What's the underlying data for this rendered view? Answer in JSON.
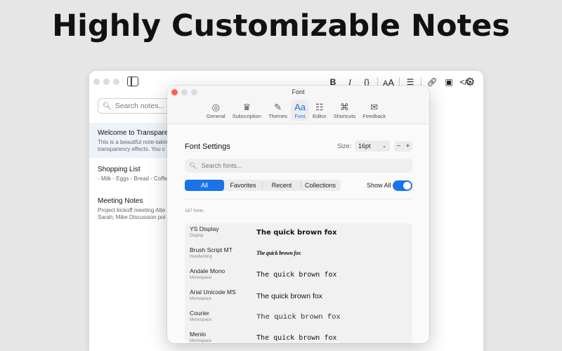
{
  "headline": "Highly Customizable Notes",
  "notes_window": {
    "search_placeholder": "Search notes...",
    "format_buttons": [
      "B",
      "I",
      "{}",
      "AA",
      "list",
      "link",
      "image",
      "</>"
    ],
    "notes": [
      {
        "title": "Welcome to Transparen",
        "preview": [
          "This is a beautiful note-takin",
          "transparency effects.  You c"
        ]
      },
      {
        "title": "Shopping List",
        "preview": [
          "- Milk - Eggs - Bread - Coffe"
        ]
      },
      {
        "title": "Meeting Notes",
        "preview": [
          "Project kickoff meeting  Atte",
          "Sarah, Mike  Discussion poi"
        ]
      }
    ]
  },
  "font_window": {
    "title": "Font",
    "tabs": [
      {
        "label": "General",
        "icon": "gauge-icon",
        "glyph": "◎"
      },
      {
        "label": "Subscription",
        "icon": "crown-icon",
        "glyph": "♛"
      },
      {
        "label": "Themes",
        "icon": "brush-icon",
        "glyph": "✎"
      },
      {
        "label": "Font",
        "icon": "font-icon",
        "glyph": "Aa"
      },
      {
        "label": "Editor",
        "icon": "document-icon",
        "glyph": "☷"
      },
      {
        "label": "Shortcuts",
        "icon": "command-icon",
        "glyph": "⌘"
      },
      {
        "label": "Feedback",
        "icon": "speech-bubble-icon",
        "glyph": "✉"
      }
    ],
    "active_tab": "Font",
    "settings_title": "Font Settings",
    "size_label": "Size:",
    "size_value": "16pt",
    "stepper_minus": "−",
    "stepper_plus": "+",
    "search_placeholder": "Search fonts...",
    "filters": [
      "All",
      "Favorites",
      "Recent",
      "Collections"
    ],
    "active_filter": "All",
    "show_all_label": "Show All",
    "show_all_on": true,
    "font_count": "187 fonts",
    "fonts": [
      {
        "name": "YS Display",
        "category": "Display",
        "sample": "The quick brown fox"
      },
      {
        "name": "Brush Script MT",
        "category": "Handwriting",
        "sample": "The quick brown fox"
      },
      {
        "name": "Andale Mono",
        "category": "Monospace",
        "sample": "The quick brown fox"
      },
      {
        "name": "Arial Unicode MS",
        "category": "Monospace",
        "sample": "The quick brown fox"
      },
      {
        "name": "Courier",
        "category": "Monospace",
        "sample": "The quick brown fox"
      },
      {
        "name": "Menlo",
        "category": "Monospace",
        "sample": "The quick brown fox"
      }
    ]
  },
  "colors": {
    "accent": "#1a73e8",
    "close": "#ff5f57",
    "inactive_light": "#dcdcdc"
  }
}
